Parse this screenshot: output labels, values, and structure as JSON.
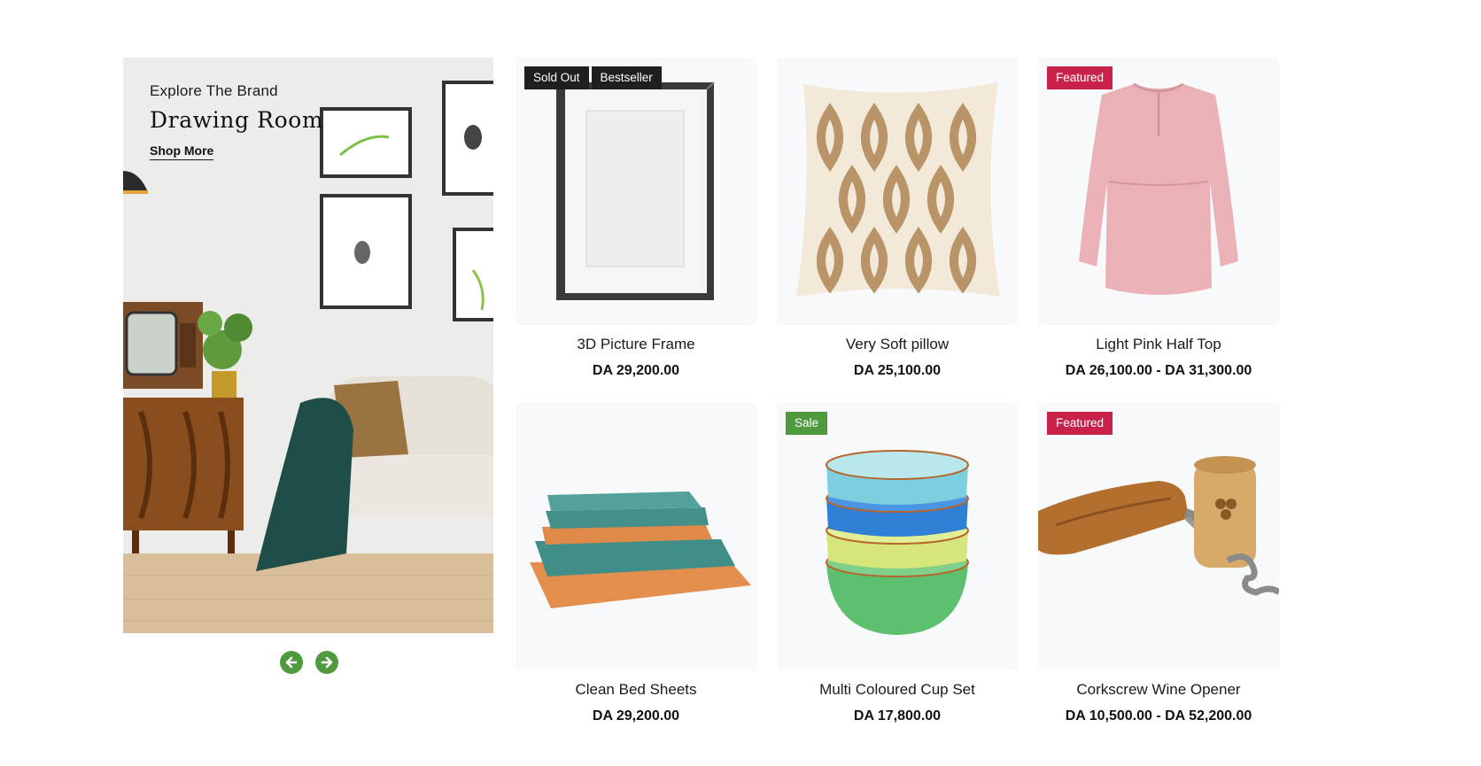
{
  "banner": {
    "eyebrow": "Explore The Brand",
    "title": "Drawing Room",
    "cta": "Shop More"
  },
  "slider": {
    "prev_icon": "arrow-left-icon",
    "next_icon": "arrow-right-icon"
  },
  "colors": {
    "accent_green": "#4f9a3e",
    "featured_red": "#c8224a",
    "badge_dark": "#1f1f1f"
  },
  "products": [
    {
      "name": "3D Picture Frame",
      "price": "DA 29,200.00",
      "badges": [
        "Sold Out",
        "Bestseller"
      ]
    },
    {
      "name": "Very Soft pillow",
      "price": "DA 25,100.00",
      "badges": []
    },
    {
      "name": "Light Pink Half Top",
      "price": "DA 26,100.00 - DA 31,300.00",
      "badges": [
        "Featured"
      ]
    },
    {
      "name": "Clean Bed Sheets",
      "price": "DA 29,200.00",
      "badges": []
    },
    {
      "name": "Multi Coloured Cup Set",
      "price": "DA 17,800.00",
      "badges": [
        "Sale"
      ]
    },
    {
      "name": "Corkscrew Wine Opener",
      "price": "DA 10,500.00 - DA 52,200.00",
      "badges": [
        "Featured"
      ]
    }
  ]
}
